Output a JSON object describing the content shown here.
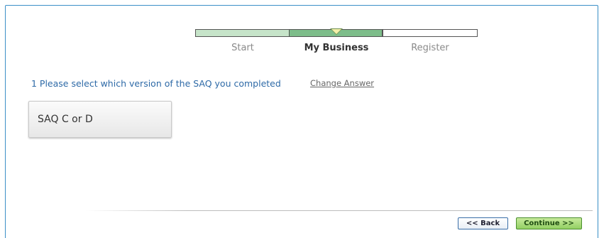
{
  "steps": [
    {
      "label": "Start",
      "state": "done"
    },
    {
      "label": "My Business",
      "state": "current"
    },
    {
      "label": "Register",
      "state": "todo"
    }
  ],
  "question": {
    "text": "1 Please select which version of the SAQ you completed",
    "change_link": "Change Answer"
  },
  "answer": {
    "label": "SAQ C or D"
  },
  "nav": {
    "back_label": "<< Back",
    "continue_label": "Continue >>"
  },
  "colors": {
    "frame_border": "#3b8fc7",
    "question_text": "#2e6aa7",
    "step_done": "#c6e4c9",
    "step_current": "#7dbd8a",
    "continue_button": "#92cf62"
  }
}
